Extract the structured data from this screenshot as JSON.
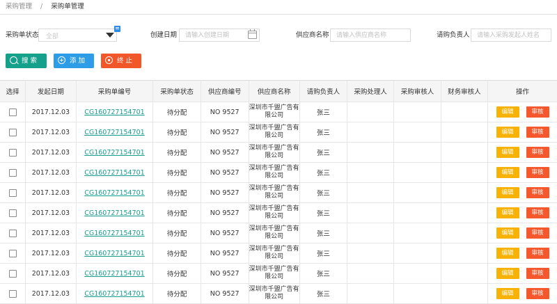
{
  "breadcrumb": {
    "parent": "采购管理",
    "separator": "/",
    "current": "采购单管理"
  },
  "filters": {
    "status_label": "采购单状态",
    "status_value": "全部",
    "date_label": "创建日期",
    "date_placeholder": "请输入创建日期",
    "supplier_label": "供应商名称",
    "supplier_placeholder": "请输入供应商名称",
    "requester_label": "请购负责人",
    "requester_placeholder": "请输入采购发起人姓名"
  },
  "actions": {
    "search": "搜 索",
    "add": "添 加",
    "stop": "终 止"
  },
  "colors": {
    "search": "#14a08a",
    "add": "#2e9de8",
    "stop": "#f2572a",
    "edit": "#f8b206",
    "audit": "#f4582c",
    "link": "#1a9c8f"
  },
  "table": {
    "columns": [
      "选择",
      "发起日期",
      "采购单编号",
      "采购单状态",
      "供应商编号",
      "供应商名称",
      "请购负责人",
      "采购处理人",
      "采购审核人",
      "财务审核人",
      "操作"
    ],
    "edit_label": "编辑",
    "audit_label": "审核",
    "rows": [
      {
        "date": "2017.12.03",
        "order_no": "CG160727154701",
        "status": "待分配",
        "supplier_no": "NO 9527",
        "supplier_name": "深圳市千盟广告有限公司",
        "requester": "张三",
        "handler": "",
        "reviewer": "",
        "finance": ""
      },
      {
        "date": "2017.12.03",
        "order_no": "CG160727154701",
        "status": "待分配",
        "supplier_no": "NO 9527",
        "supplier_name": "深圳市千盟广告有限公司",
        "requester": "张三",
        "handler": "",
        "reviewer": "",
        "finance": ""
      },
      {
        "date": "2017.12.03",
        "order_no": "CG160727154701",
        "status": "待分配",
        "supplier_no": "NO 9527",
        "supplier_name": "深圳市千盟广告有限公司",
        "requester": "张三",
        "handler": "",
        "reviewer": "",
        "finance": ""
      },
      {
        "date": "2017.12.03",
        "order_no": "CG160727154701",
        "status": "待分配",
        "supplier_no": "NO 9527",
        "supplier_name": "深圳市千盟广告有限公司",
        "requester": "张三",
        "handler": "",
        "reviewer": "",
        "finance": ""
      },
      {
        "date": "2017.12.03",
        "order_no": "CG160727154701",
        "status": "待分配",
        "supplier_no": "NO 9527",
        "supplier_name": "深圳市千盟广告有限公司",
        "requester": "张三",
        "handler": "",
        "reviewer": "",
        "finance": ""
      },
      {
        "date": "2017.12.03",
        "order_no": "CG160727154701",
        "status": "待分配",
        "supplier_no": "NO 9527",
        "supplier_name": "深圳市千盟广告有限公司",
        "requester": "张三",
        "handler": "",
        "reviewer": "",
        "finance": ""
      },
      {
        "date": "2017.12.03",
        "order_no": "CG160727154701",
        "status": "待分配",
        "supplier_no": "NO 9527",
        "supplier_name": "深圳市千盟广告有限公司",
        "requester": "张三",
        "handler": "",
        "reviewer": "",
        "finance": ""
      },
      {
        "date": "2017.12.03",
        "order_no": "CG160727154701",
        "status": "待分配",
        "supplier_no": "NO 9527",
        "supplier_name": "深圳市千盟广告有限公司",
        "requester": "张三",
        "handler": "",
        "reviewer": "",
        "finance": ""
      },
      {
        "date": "2017.12.03",
        "order_no": "CG160727154701",
        "status": "待分配",
        "supplier_no": "NO 9527",
        "supplier_name": "深圳市千盟广告有限公司",
        "requester": "张三",
        "handler": "",
        "reviewer": "",
        "finance": ""
      },
      {
        "date": "2017.12.03",
        "order_no": "CG160727154701",
        "status": "待分配",
        "supplier_no": "NO 9527",
        "supplier_name": "深圳市千盟广告有限公司",
        "requester": "张三",
        "handler": "",
        "reviewer": "",
        "finance": ""
      }
    ]
  }
}
